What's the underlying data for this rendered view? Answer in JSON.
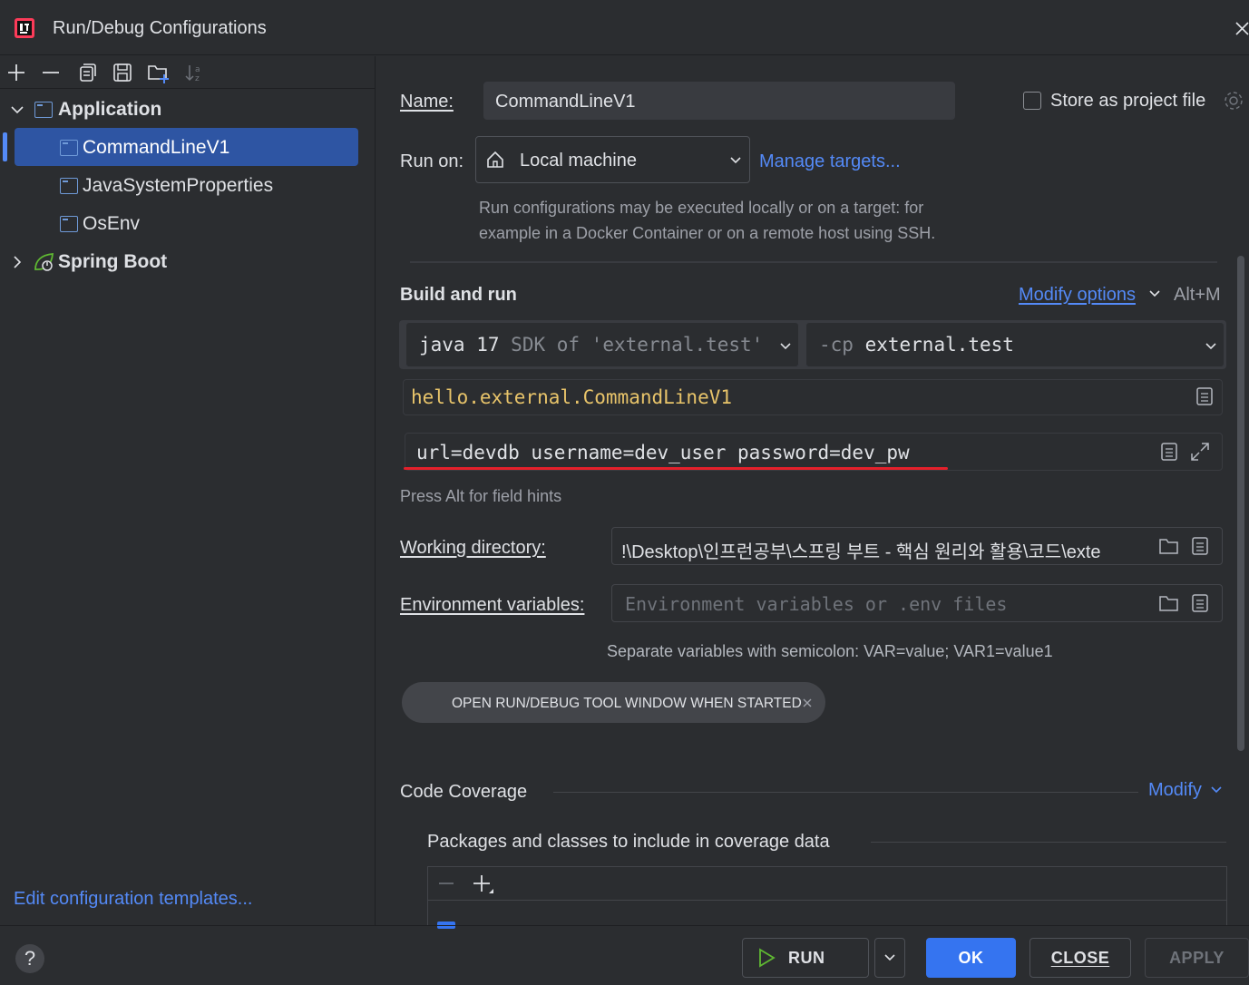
{
  "window": {
    "title": "Run/Debug Configurations"
  },
  "tree": {
    "application": "Application",
    "items": [
      "CommandLineV1",
      "JavaSystemProperties",
      "OsEnv"
    ],
    "spring_boot": "Spring Boot"
  },
  "left_footer": {
    "edit_templates": "Edit configuration templates..."
  },
  "form": {
    "name_label": "Name:",
    "name_value": "CommandLineV1",
    "store_label": "Store as project file",
    "run_on_label": "Run on:",
    "run_on_value": "Local machine",
    "manage_targets": "Manage targets...",
    "run_on_hint_1": "Run configurations may be executed locally or on a target: for",
    "run_on_hint_2": "example in a Docker Container or on a remote host using SSH.",
    "build_run": "Build and run",
    "modify_options": "Modify options",
    "shortcut": "Alt+M",
    "sdk_java": "java 17",
    "sdk_rest": "SDK of 'external.test'",
    "cp_flag": "-cp",
    "cp_value": "external.test",
    "main_class": "hello.external.CommandLineV1",
    "program_args": "url=devdb username=dev_user password=dev_pw",
    "press_alt": "Press Alt for field hints",
    "workdir_label": "Working directory:",
    "workdir_value": "!\\Desktop\\인프런공부\\스프링 부트 - 핵심 원리와 활용\\코드\\exte",
    "env_label": "Environment variables:",
    "env_placeholder": "Environment variables or .env files",
    "env_hint": "Separate variables with semicolon: VAR=value; VAR1=value1",
    "open_tool_chip": "OPEN RUN/DEBUG TOOL WINDOW WHEN STARTED",
    "code_coverage": "Code Coverage",
    "modify": "Modify",
    "packages_label": "Packages and classes to include in coverage data"
  },
  "buttons": {
    "help": "?",
    "run": "RUN",
    "ok": "OK",
    "close": "CLOSE",
    "apply": "APPLY"
  },
  "colors": {
    "accent": "#548af7",
    "selection": "#2e55a3",
    "ok_button": "#3574f0",
    "error_underline": "#e5202b",
    "class_text": "#e8c46a"
  }
}
